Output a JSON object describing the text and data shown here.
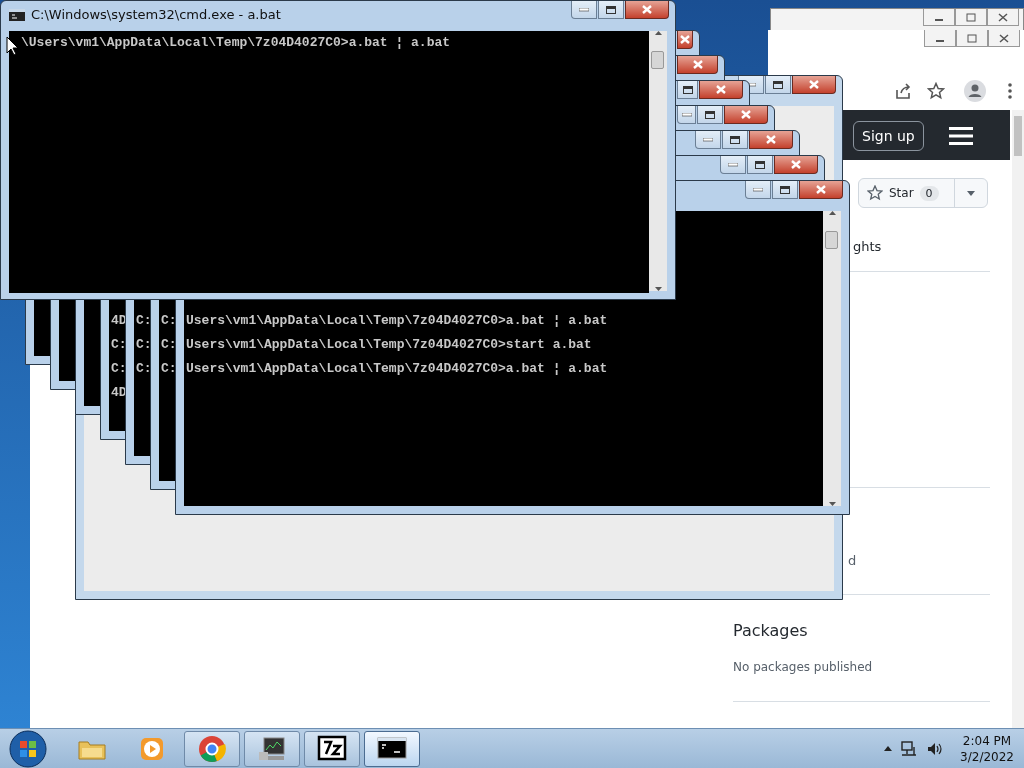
{
  "console_window": {
    "title": "C:\\Windows\\system32\\cmd.exe - a.bat",
    "lines": [
      "\\Users\\vm1\\AppData\\Local\\Temp\\7z04D4027C0>a.bat ¦ a.bat"
    ]
  },
  "background_windows": [
    {
      "kind": "blank"
    },
    {
      "kind": "console"
    },
    {
      "kind": "console"
    },
    {
      "kind": "console"
    },
    {
      "kind": "console",
      "lines": [
        "4D",
        "C:",
        "C:",
        "4D"
      ]
    },
    {
      "kind": "console",
      "lines": [
        "C:",
        "C:",
        "C:"
      ]
    },
    {
      "kind": "console",
      "lines": [
        "C:",
        "C:",
        "C:"
      ]
    },
    {
      "kind": "console",
      "lines": [
        "Users\\vm1\\AppData\\Local\\Temp\\7z04D4027C0>a.bat ¦ a.bat",
        "Users\\vm1\\AppData\\Local\\Temp\\7z04D4027C0>start a.bat",
        "Users\\vm1\\AppData\\Local\\Temp\\7z04D4027C0>a.bat ¦ a.bat"
      ]
    }
  ],
  "browser": {
    "sign_up": "Sign up",
    "star_button": {
      "label": "Star",
      "count": "0"
    },
    "tab_fragment": "ghts",
    "about_fragment": "d",
    "packages": {
      "title": "Packages",
      "text": "No packages published"
    }
  },
  "taskbar": {
    "buttons": [
      {
        "kind": "explorer",
        "running": false,
        "selected": false
      },
      {
        "kind": "media",
        "running": false,
        "selected": false
      },
      {
        "kind": "chrome",
        "running": true,
        "selected": false
      },
      {
        "kind": "monitor",
        "running": true,
        "selected": false
      },
      {
        "kind": "sevenzip",
        "running": true,
        "selected": false
      },
      {
        "kind": "console",
        "running": true,
        "selected": true
      }
    ],
    "clock": {
      "time": "2:04 PM",
      "date": "3/2/2022"
    }
  }
}
